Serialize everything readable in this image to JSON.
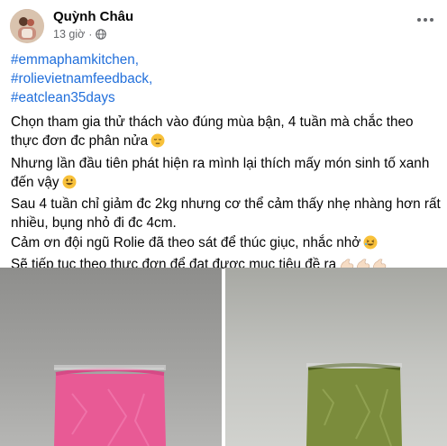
{
  "post": {
    "author": "Quỳnh Châu",
    "timestamp": "13 giờ",
    "separator": "·",
    "privacy_icon": "globe-icon",
    "more_icon": "more-options-icon"
  },
  "hashtags": [
    "#emmaphamkitchen,",
    "#rolievietnamfeedback,",
    "#eatclean35days"
  ],
  "body": {
    "line1": "Chọn tham gia thử thách vào đúng mùa bận, 4 tuần mà chắc theo thực đơn đc phân nửa",
    "line1_emoji": "😔",
    "line2": "Nhưng lần đầu tiên phát hiện ra mình lại thích mấy món sinh tố xanh đến vậy",
    "line2_emoji": "😀",
    "line3": "Sau 4 tuần chỉ giảm đc 2kg nhưng cơ thể cảm thấy nhẹ nhàng hơn rất nhiều, bụng nhỏ đi đc 4cm.",
    "line4": "Cảm ơn đội ngũ Rolie đã theo sát để thúc giục, nhắc nhở",
    "line4_emoji": "🤣",
    "line5": "Sẽ tiếp tục theo thực đơn để đạt được mục tiêu đề ra",
    "line5_emoji": "💪🏻💪🏻💪🏻"
  },
  "colors": {
    "link": "#216fdb",
    "meta": "#65676b",
    "pink_smoothie": "#e24d8a",
    "green_smoothie": "#7a8a3a"
  }
}
